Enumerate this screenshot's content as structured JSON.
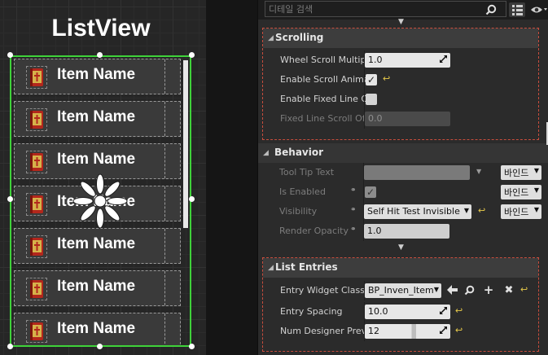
{
  "designer": {
    "widget_title": "ListView",
    "list_items": [
      {
        "label": "Item Name"
      },
      {
        "label": "Item Name"
      },
      {
        "label": "Item Name"
      },
      {
        "label": "Item Name"
      },
      {
        "label": "Item Name"
      },
      {
        "label": "Item Name"
      },
      {
        "label": "Item Name"
      }
    ],
    "selection_color": "#3fd23a"
  },
  "details": {
    "search": {
      "placeholder": "디테일 검색"
    },
    "icons": {
      "search": "search-icon",
      "view": "eye-icon",
      "table": "table-view-icon",
      "collapse": "collapse-arrow-icon"
    },
    "categories": {
      "scrolling": {
        "title": "Scrolling",
        "rows": [
          {
            "label": "Wheel Scroll Multiplier",
            "value": "1.0"
          },
          {
            "label": "Enable Scroll Animation",
            "checked": true
          },
          {
            "label": "Enable Fixed Line Offset",
            "checked": false
          },
          {
            "label": "Fixed Line Scroll Offset",
            "value": "0.0",
            "disabled": true
          }
        ]
      },
      "behavior": {
        "title": "Behavior",
        "rows": [
          {
            "label": "Tool Tip Text",
            "bind": "바인드"
          },
          {
            "label": "Is Enabled",
            "checked": true,
            "bind": "바인드"
          },
          {
            "label": "Visibility",
            "value": "Self Hit Test Invisible",
            "bind": "바인드"
          },
          {
            "label": "Render Opacity",
            "value": "1.0"
          }
        ]
      },
      "list_entries": {
        "title": "List Entries",
        "rows": [
          {
            "label": "Entry Widget Class",
            "value": "BP_Inven_Item"
          },
          {
            "label": "Entry Spacing",
            "value": "10.0"
          },
          {
            "label": "Num Designer Preview Entries",
            "value": "12"
          }
        ]
      }
    }
  },
  "colors": {
    "accent_reset": "#e6c94a",
    "category_outline": "#c84d3d"
  }
}
